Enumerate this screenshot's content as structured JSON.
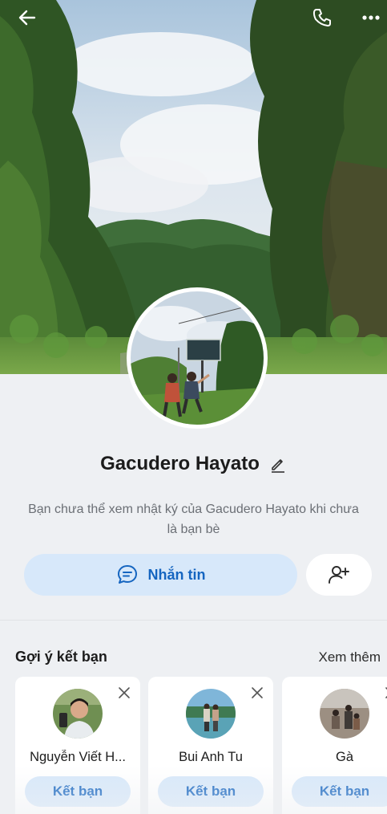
{
  "profile": {
    "name": "Gacudero Hayato",
    "notice": "Bạn chưa thể xem nhật ký của Gacudero Hayato khi chưa là bạn bè"
  },
  "actions": {
    "message_label": "Nhắn tin"
  },
  "suggestions": {
    "title": "Gợi ý kết bạn",
    "see_more": "Xem thêm",
    "cards": [
      {
        "name": "Nguyễn Viết H...",
        "button": "Kết bạn"
      },
      {
        "name": "Bui Anh Tu",
        "button": "Kết bạn"
      },
      {
        "name": "Gà",
        "button": "Kết bạn"
      }
    ]
  },
  "icons": {
    "back": "arrow-left-icon",
    "call": "phone-icon",
    "more": "more-horizontal-icon",
    "edit": "pencil-icon",
    "message": "chat-bubble-icon",
    "add_friend": "add-user-icon",
    "close": "close-icon"
  },
  "colors": {
    "accent": "#1565c0",
    "accent_soft": "#d7e8fa",
    "background": "#eef0f3"
  }
}
